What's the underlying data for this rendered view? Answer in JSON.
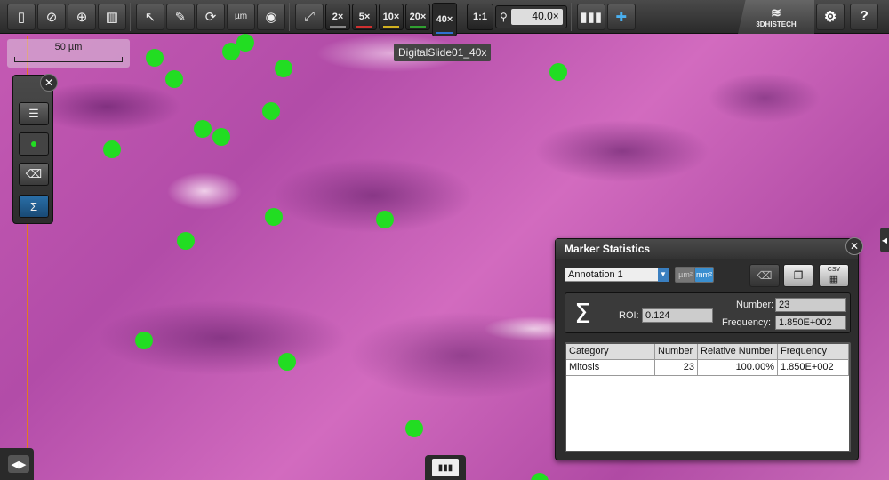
{
  "toolbar": {
    "zoom_levels": [
      "2×",
      "5×",
      "10×",
      "20×",
      "40×"
    ],
    "zoom_colors": [
      "#888888",
      "#d03030",
      "#d0b020",
      "#30a030",
      "#3070d0"
    ],
    "ratio_label": "1:1",
    "zoom_value": "40.0×",
    "unit_tool": "µm",
    "brand": "3DHISTECH"
  },
  "viewer": {
    "scale_label": "50 µm",
    "slide_title": "DigitalSlide01_40x",
    "markers": 23
  },
  "marker_stats": {
    "title": "Marker Statistics",
    "annotation": "Annotation 1",
    "unit_um": "µm²",
    "unit_mm": "mm²",
    "csv_label": "CSV",
    "sigma": "Σ",
    "roi_label": "ROI:",
    "roi_value": "0.124",
    "number_label": "Number:",
    "number_value": "23",
    "frequency_label": "Frequency:",
    "frequency_value": "1.850E+002",
    "columns": [
      "Category",
      "Number",
      "Relative Number",
      "Frequency"
    ],
    "rows": [
      {
        "category": "Mitosis",
        "number": "23",
        "relative": "100.00%",
        "frequency": "1.850E+002"
      }
    ]
  }
}
